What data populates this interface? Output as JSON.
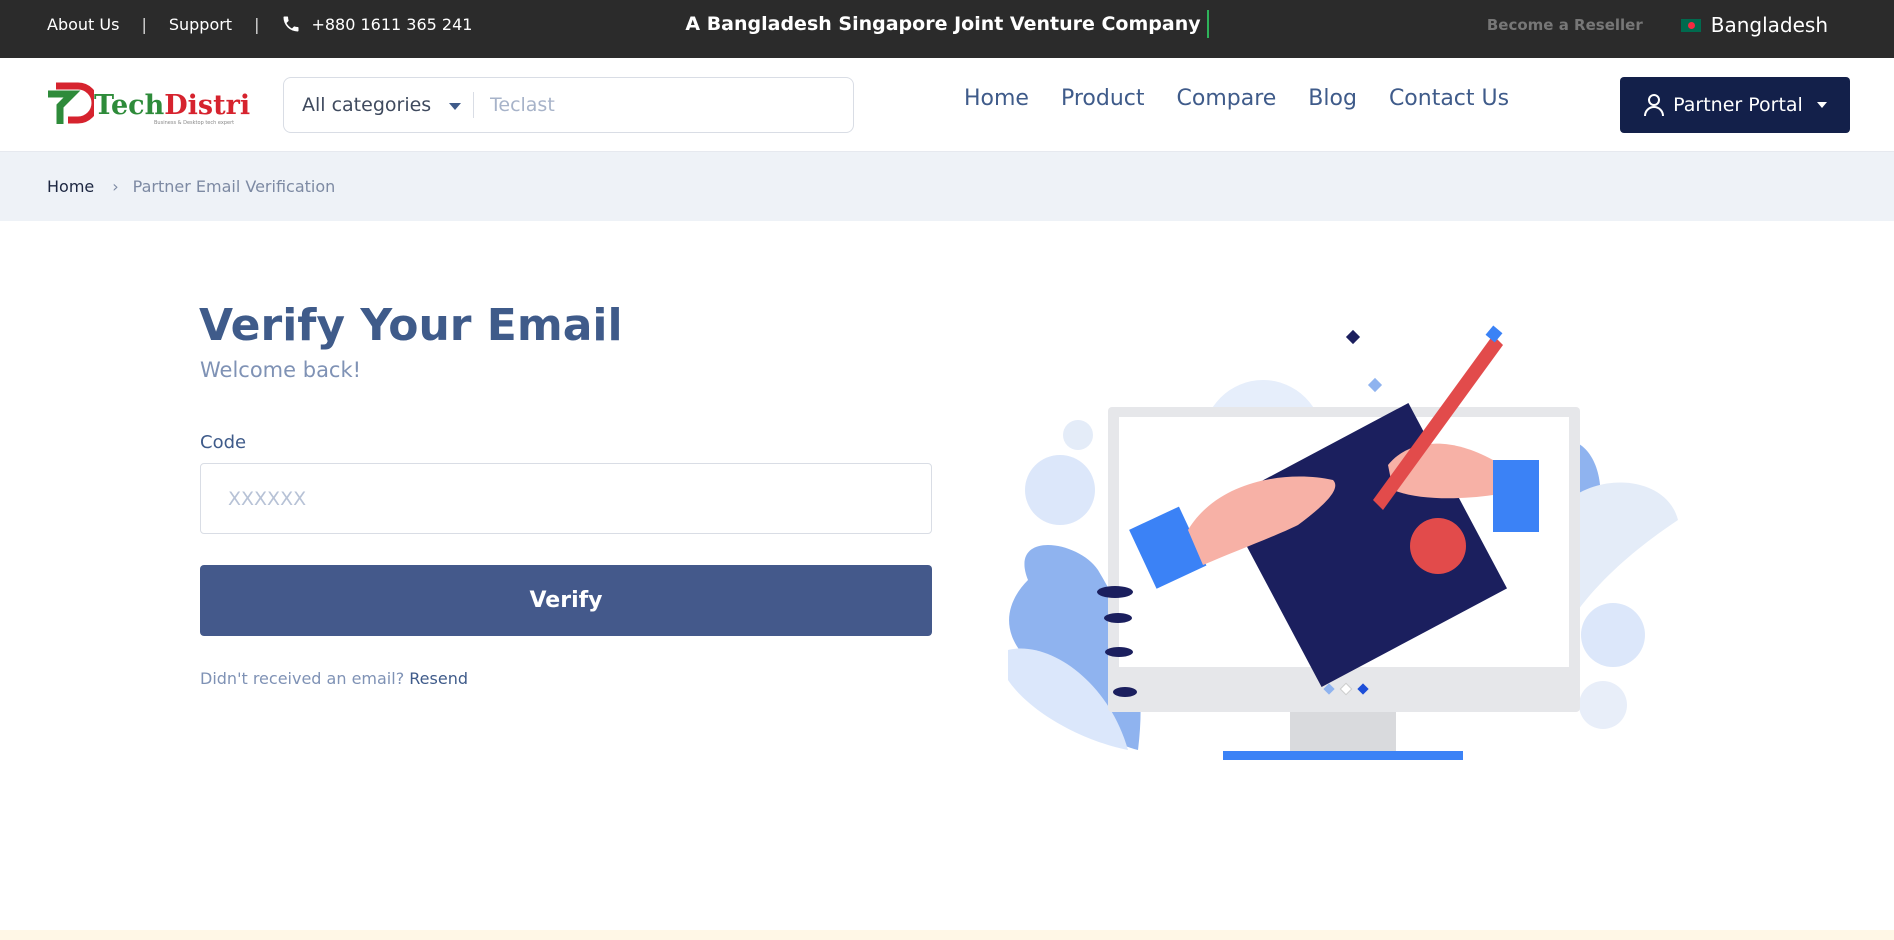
{
  "topbar": {
    "about": "About Us",
    "support": "Support",
    "separator": "|",
    "phone": "+880 1611 365 241",
    "tagline": "A Bangladesh Singapore Joint Venture Company",
    "reseller": "Become a Reseller",
    "country": "Bangladesh"
  },
  "header": {
    "logo_tech": "Tech",
    "logo_distri": "Distri",
    "logo_tagline": "Business & Desktop tech expert",
    "search": {
      "category": "All categories",
      "placeholder": "Teclast"
    },
    "nav": [
      "Home",
      "Product",
      "Compare",
      "Blog",
      "Contact Us"
    ],
    "portal_label": "Partner Portal"
  },
  "breadcrumb": {
    "home": "Home",
    "current": "Partner Email Verification"
  },
  "form": {
    "title": "Verify Your Email",
    "subtitle": "Welcome back!",
    "code_label": "Code",
    "code_placeholder": "XXXXXX",
    "verify_label": "Verify",
    "resend_prompt": "Didn't received an email?",
    "resend_link": "Resend"
  },
  "colors": {
    "topbar_bg": "#2b2b2b",
    "brand_navy": "#13204a",
    "primary": "#44598b",
    "text_blue": "#3f5b8a"
  }
}
